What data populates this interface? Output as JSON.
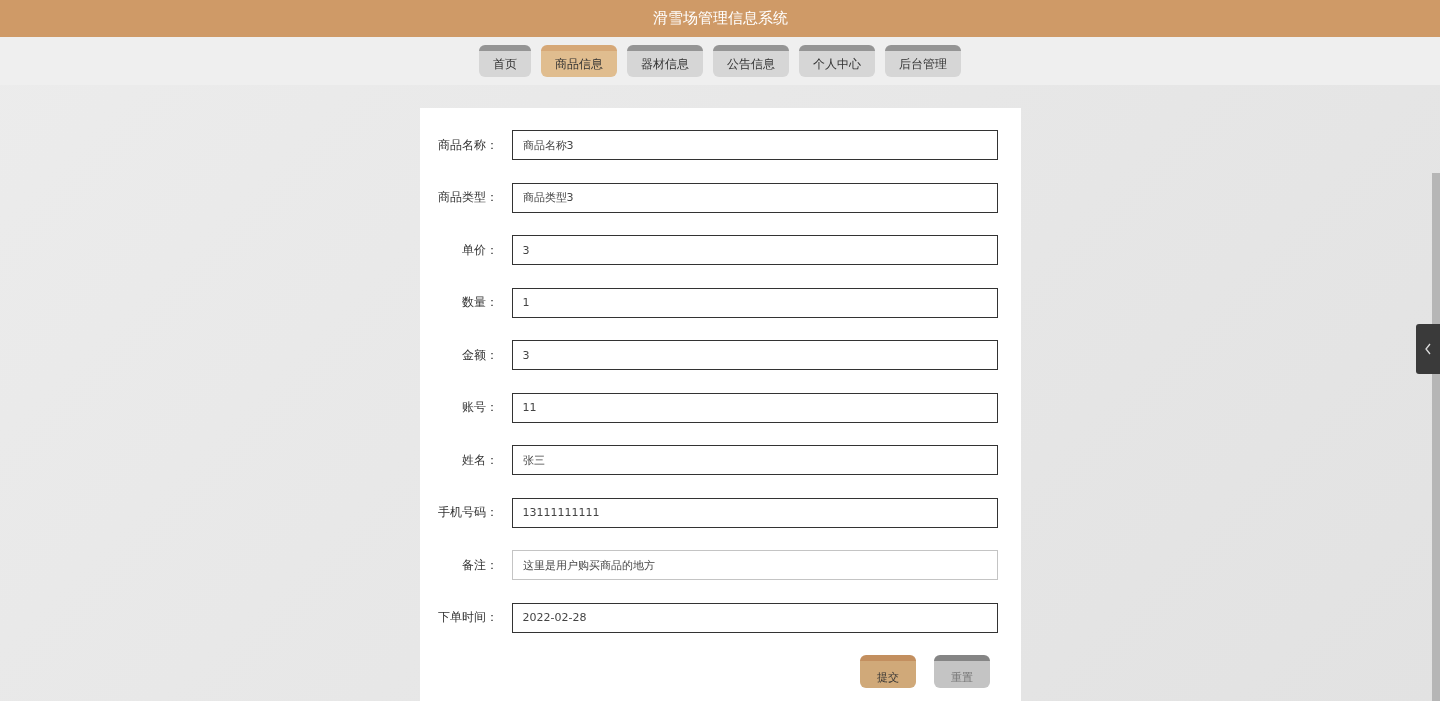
{
  "header": {
    "title": "滑雪场管理信息系统"
  },
  "tabs": [
    {
      "label": "首页",
      "selected": false
    },
    {
      "label": "商品信息",
      "selected": true
    },
    {
      "label": "器材信息",
      "selected": false
    },
    {
      "label": "公告信息",
      "selected": false
    },
    {
      "label": "个人中心",
      "selected": false
    },
    {
      "label": "后台管理",
      "selected": false
    }
  ],
  "form": {
    "fields": [
      {
        "label": "商品名称：",
        "value": "商品名称3",
        "focused": false
      },
      {
        "label": "商品类型：",
        "value": "商品类型3",
        "focused": false
      },
      {
        "label": "单价：",
        "value": "3",
        "focused": false
      },
      {
        "label": "数量：",
        "value": "1",
        "focused": false
      },
      {
        "label": "金额：",
        "value": "3",
        "focused": false
      },
      {
        "label": "账号：",
        "value": "11",
        "focused": false
      },
      {
        "label": "姓名：",
        "value": "张三",
        "focused": false
      },
      {
        "label": "手机号码：",
        "value": "13111111111",
        "focused": false
      },
      {
        "label": "备注：",
        "value": "这里是用户购买商品的地方",
        "focused": true
      },
      {
        "label": "下单时间：",
        "value": "2022-02-28",
        "focused": false
      }
    ],
    "buttons": [
      {
        "label": "提交",
        "kind": "primary"
      },
      {
        "label": "重置",
        "kind": "secondary"
      }
    ]
  }
}
